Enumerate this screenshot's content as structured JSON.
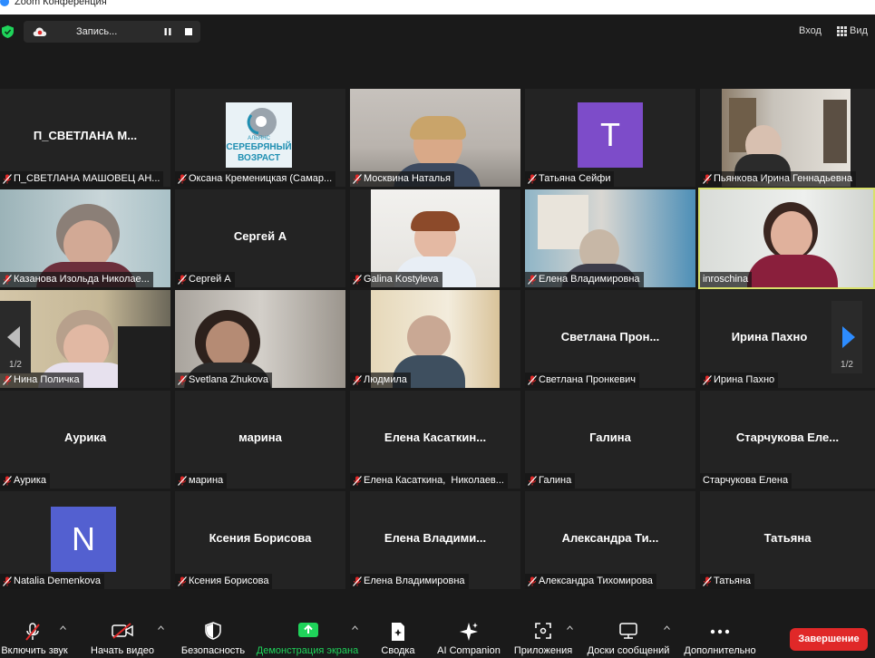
{
  "window": {
    "title": "Zoom Конференция"
  },
  "recording": {
    "label": "Запись..."
  },
  "top_right": {
    "enter": "Вход",
    "view": "Вид"
  },
  "pagination": {
    "left": "1/2",
    "right": "1/2"
  },
  "tiles": [
    {
      "center": "П_СВЕТЛАНА М...",
      "label": "П_СВЕТЛАНА МАШОВЕЦ АН..."
    },
    {
      "label": "Оксана Кременицкая (Самар..."
    },
    {
      "label": "Москвина Наталья"
    },
    {
      "label": "Татьяна Сейфи",
      "avatar_letter": "T"
    },
    {
      "label": "Пьянкова Ирина Геннадьевна"
    },
    {
      "label": "Казанова Изольда Николае..."
    },
    {
      "center": "Сергей А",
      "label": "Сергей А"
    },
    {
      "label": "Galina Kostyleva"
    },
    {
      "label": "Елена Владимировна"
    },
    {
      "label": "inroschina"
    },
    {
      "label": "Нина Поличка"
    },
    {
      "label": "Svetlana Zhukova"
    },
    {
      "label": "Людмила"
    },
    {
      "center": "Светлана Прон...",
      "label": "Светлана Пронкевич"
    },
    {
      "center": "Ирина Пахно",
      "label": "Ирина Пахно"
    },
    {
      "center": "Аурика",
      "label": "Аурика"
    },
    {
      "center": "марина",
      "label": "марина"
    },
    {
      "center": "Елена Касаткин...",
      "label": "Елена Касаткина,  Николаев..."
    },
    {
      "center": "Галина",
      "label": "Галина"
    },
    {
      "center": "Старчукова Еле...",
      "label": "Старчукова Елена"
    },
    {
      "label": "Natalia Demenkova",
      "avatar_letter": "N"
    },
    {
      "center": "Ксения Борисова",
      "label": "Ксения Борисова"
    },
    {
      "center": "Елена Владими...",
      "label": "Елена Владимировна"
    },
    {
      "center": "Александра Ти...",
      "label": "Александра Тихомирова"
    },
    {
      "center": "Татьяна",
      "label": "Татьяна"
    }
  ],
  "logo": {
    "line1": "АЛЬЯНС",
    "line2": "СЕРЕБРЯНЫЙ",
    "line3": "ВОЗРАСТ"
  },
  "toolbar": {
    "mute": "Включить звук",
    "video": "Начать видео",
    "security": "Безопасность",
    "share": "Демонстрация экрана",
    "summary": "Сводка",
    "ai": "AI Companion",
    "apps": "Приложения",
    "whiteboards": "Доски сообщений",
    "more": "Дополнительно",
    "end": "Завершение"
  },
  "colors": {
    "share_green": "#1fd35a",
    "end_red": "#e02828",
    "active_border": "#d8e06a",
    "avatar_purple": "#7d4cc9",
    "avatar_indigo": "#5360d0"
  },
  "icons": {
    "muted": "mic-off-icon",
    "video_off": "video-off-icon",
    "shield": "shield-icon",
    "share": "share-screen-icon",
    "summary": "summary-icon",
    "ai": "sparkle-icon",
    "apps": "apps-icon",
    "whiteboard": "whiteboard-icon",
    "more": "more-icon"
  }
}
